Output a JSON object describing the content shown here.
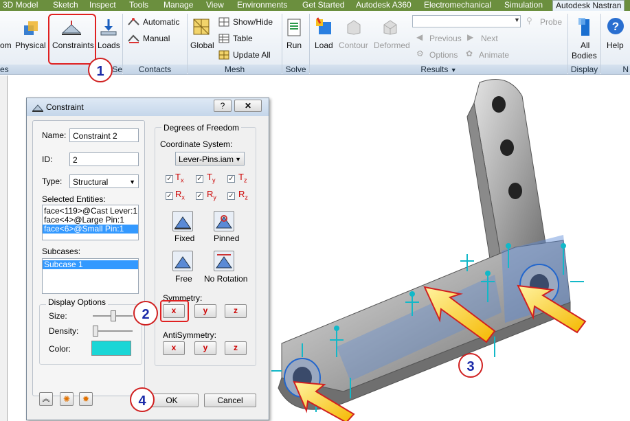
{
  "tabs": [
    "3D Model",
    "Sketch",
    "Inspect",
    "Tools",
    "Manage",
    "View",
    "Environments",
    "Get Started",
    "Autodesk A360",
    "Electromechanical",
    "Simulation",
    "Autodesk Nastran"
  ],
  "ribbon": {
    "om_label": "om",
    "physical": "Physical",
    "constraints": "Constraints",
    "loads": "Loads",
    "automatic": "Automatic",
    "manual": "Manual",
    "global": "Global",
    "show_hide": "Show/Hide",
    "table": "Table",
    "update_all": "Update  All",
    "run": "Run",
    "load": "Load",
    "contour": "Contour",
    "deformed": "Deformed",
    "previous": "Previous",
    "next": "Next",
    "options": "Options",
    "animate": "Animate",
    "probe": "Probe",
    "all_bodies_1": "All",
    "all_bodies_2": "Bodies",
    "help": "Help",
    "groups": {
      "es": "es",
      "se": "Se",
      "contacts": "Contacts",
      "mesh": "Mesh",
      "solve": "Solve",
      "results": "Results",
      "display": "Display",
      "n": "N"
    }
  },
  "dialog": {
    "title": "Constraint",
    "help_btn": "?",
    "name_label": "Name:",
    "name_value": "Constraint 2",
    "id_label": "ID:",
    "id_value": "2",
    "type_label": "Type:",
    "type_value": "Structural",
    "selected_label": "Selected Entities:",
    "entities": [
      "face<119>@Cast Lever:1",
      "face<4>@Large Pin:1",
      "face<6>@Small Pin:1"
    ],
    "subcases_label": "Subcases:",
    "subcases": [
      "Subcase 1"
    ],
    "display_options": "Display Options",
    "size_label": "Size:",
    "density_label": "Density:",
    "color_label": "Color:",
    "color": "#1ad6d6",
    "dof_title": "Degrees of Freedom",
    "coord_label": "Coordinate System:",
    "coord_value": "Lever-Pins.iam",
    "t": "T",
    "r": "R",
    "sx": "x",
    "sy": "y",
    "sz": "z",
    "fixed": "Fixed",
    "pinned": "Pinned",
    "free": "Free",
    "no_rotation": "No Rotation",
    "symmetry": "Symmetry:",
    "antisymmetry": "AntiSymmetry:",
    "sym_x": "x",
    "sym_y": "y",
    "sym_z": "z",
    "ok": "OK",
    "cancel": "Cancel"
  },
  "callouts": [
    "1",
    "2",
    "3",
    "4"
  ]
}
